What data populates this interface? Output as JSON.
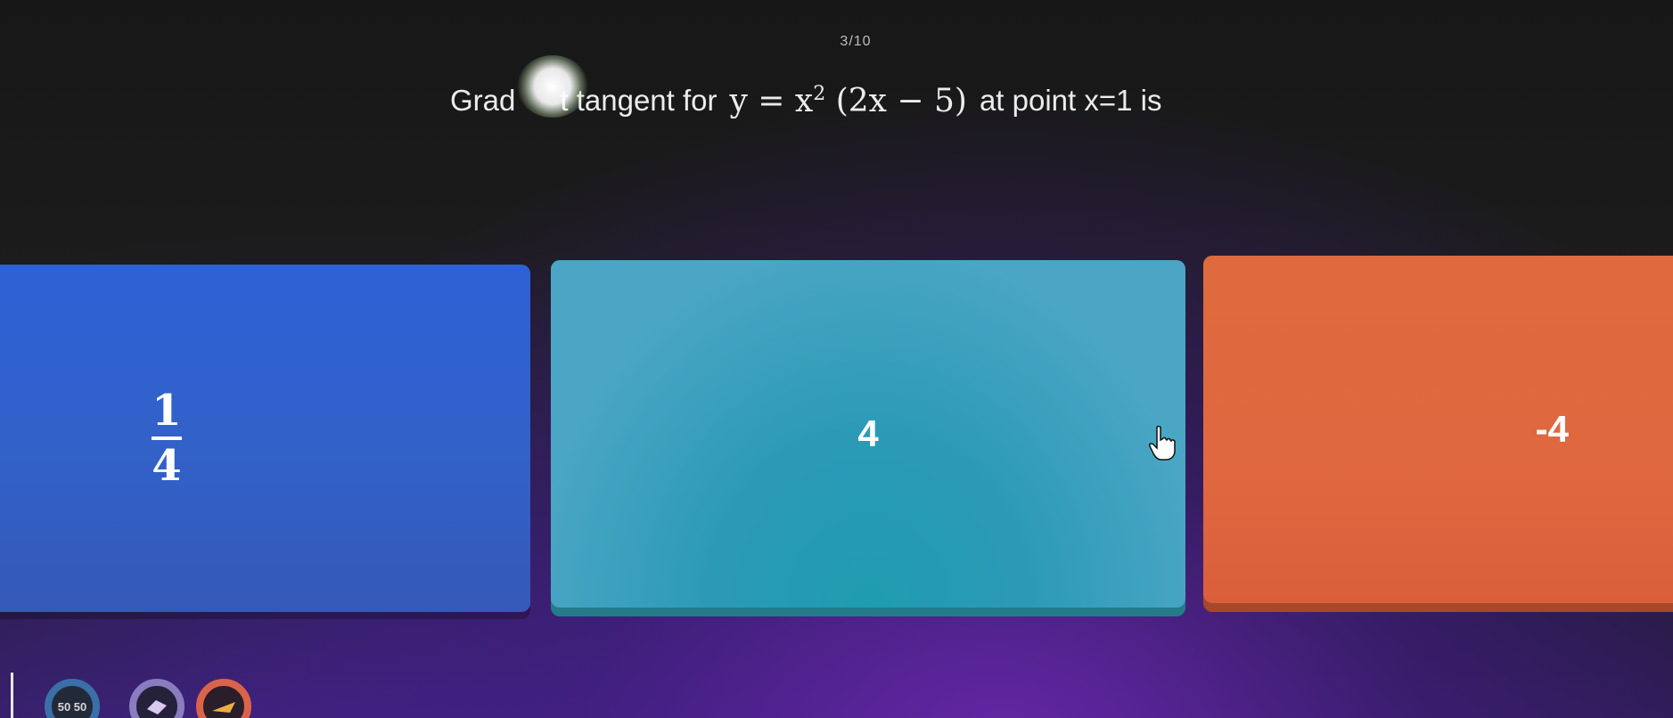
{
  "progress": "3/10",
  "question": {
    "prefix": "Grad",
    "middle": "t tangent for",
    "math": {
      "lhs": "y",
      "eq": "=",
      "base": "x",
      "exp": "2",
      "factor": "(2x − 5)"
    },
    "suffix": "at point x=1 is"
  },
  "options": [
    {
      "type": "fraction",
      "numerator": "1",
      "denominator": "4",
      "color": "#3261c8"
    },
    {
      "type": "text",
      "label": "4",
      "color": "#4aa6c4"
    },
    {
      "type": "text",
      "label": "-4",
      "color": "#e06840"
    }
  ],
  "toolbar": {
    "powerup_5050_label": "50 50",
    "items": [
      "fifty-fifty-icon",
      "eraser-icon",
      "power-icon"
    ]
  },
  "colors": {
    "option_blue": "#3261c8",
    "option_teal": "#4aa6c4",
    "option_orange": "#e06840"
  }
}
